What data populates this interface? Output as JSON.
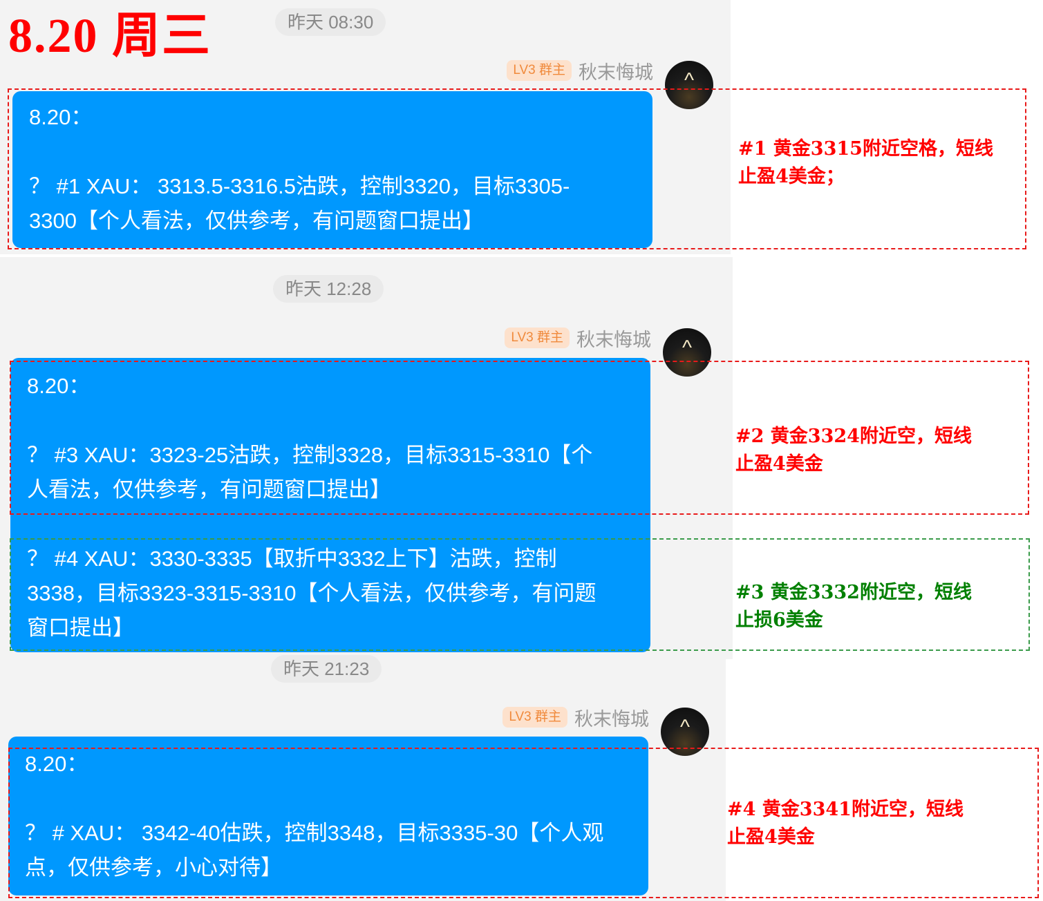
{
  "page_title": "8.20 周三",
  "messages": [
    {
      "time": "昨天 08:30",
      "badge": "LV3 群主",
      "sender": "秋末悔城",
      "lines": [
        "8.20：",
        "",
        "？ #1 XAU： 3313.5-3316.5沽跌，控制3320，目标3305-",
        "3300【个人看法，仅供参考，有问题窗口提出】"
      ]
    },
    {
      "time": "昨天 12:28",
      "badge": "LV3 群主",
      "sender": "秋末悔城",
      "lines": [
        "8.20：",
        "",
        "？ #3 XAU：3323-25沽跌，控制3328，目标3315-3310【个",
        "人看法，仅供参考，有问题窗口提出】",
        "",
        "？ #4 XAU：3330-3335【取折中3332上下】沽跌，控制",
        "3338，目标3323-3315-3310【个人看法，仅供参考，有问题",
        "窗口提出】"
      ]
    },
    {
      "time": "昨天 21:23",
      "badge": "LV3 群主",
      "sender": "秋末悔城",
      "lines": [
        "8.20：",
        "",
        "？ # XAU： 3342-40估跌，控制3348，目标3335-30【个人观",
        "点，仅供参考，小心对待】"
      ]
    }
  ],
  "annotations": [
    {
      "color": "red",
      "lines": [
        "#1 黄金3315附近空格，短线",
        "止盈4美金；"
      ]
    },
    {
      "color": "red",
      "lines": [
        "#2 黄金3324附近空，短线",
        "止盈4美金"
      ]
    },
    {
      "color": "green",
      "lines": [
        "#3 黄金3332附近空，短线",
        "止损6美金"
      ]
    },
    {
      "color": "red",
      "lines": [
        "#4 黄金3341附近空，短线",
        "止盈4美金"
      ]
    }
  ],
  "colors": {
    "bubble": "#0098fe",
    "annotation_red": "#ff0000",
    "annotation_green": "#008000",
    "badge_text": "#f08a3c",
    "badge_bg": "#fde1cc"
  },
  "icons": {
    "avatar": "avatar-chevron-icon"
  }
}
